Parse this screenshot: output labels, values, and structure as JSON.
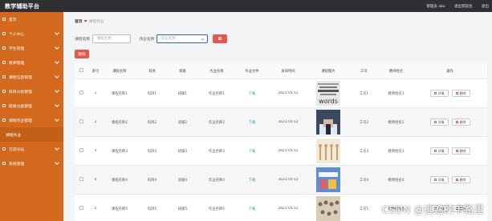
{
  "app": {
    "title": "教学辅助平台"
  },
  "topbar": {
    "links": [
      "管理员 abo",
      "退出到前台",
      "退出"
    ]
  },
  "sidebar": {
    "items": [
      {
        "label": "首页",
        "sub": false,
        "chevron": false
      },
      {
        "label": "个人中心",
        "sub": false,
        "chevron": true
      },
      {
        "label": "学生管理",
        "sub": false,
        "chevron": true
      },
      {
        "label": "教师管理",
        "sub": false,
        "chevron": true
      },
      {
        "label": "课程信息管理",
        "sub": false,
        "chevron": true
      },
      {
        "label": "科目分类管理",
        "sub": false,
        "chevron": true
      },
      {
        "label": "班级分类管理",
        "sub": false,
        "chevron": true
      },
      {
        "label": "课程作业管理",
        "sub": false,
        "chevron": true
      },
      {
        "label": "课程作业",
        "sub": true,
        "chevron": false
      },
      {
        "label": "交流论坛",
        "sub": false,
        "chevron": true
      },
      {
        "label": "系统管理",
        "sub": false,
        "chevron": true
      }
    ]
  },
  "breadcrumb": {
    "home": "首页",
    "current": "课程作业"
  },
  "search": {
    "course_label": "课程名称",
    "course_placeholder": "课程名称",
    "homework_label": "作业名称",
    "homework_placeholder": "作业名称"
  },
  "toolbar": {
    "delete_label": "删除"
  },
  "table": {
    "headers": [
      "索引",
      "课程名称",
      "科目",
      "班级",
      "作业名称",
      "作业文件",
      "发布时间",
      "课程图片",
      "工号",
      "教师姓名",
      "操作"
    ],
    "rows": [
      {
        "index": "1",
        "course": "课程名称1",
        "subject": "科目1",
        "class": "班级1",
        "homework": "作业名称1",
        "file": "下载",
        "time": "2021-05-12",
        "no": "工号1",
        "teacher": "教师姓名1",
        "thumb": "words"
      },
      {
        "index": "2",
        "course": "课程名称2",
        "subject": "科目2",
        "class": "班级2",
        "homework": "作业名称2",
        "file": "下载",
        "time": "2021-05-12",
        "no": "工号2",
        "teacher": "教师姓名2",
        "thumb": "suit"
      },
      {
        "index": "3",
        "course": "课程名称3",
        "subject": "科目3",
        "class": "班级3",
        "homework": "作业名称3",
        "file": "下载",
        "time": "2021-05-12",
        "no": "工号3",
        "teacher": "教师姓名3",
        "thumb": "figures"
      },
      {
        "index": "4",
        "course": "课程名称4",
        "subject": "科目4",
        "class": "班级4",
        "homework": "作业名称4",
        "file": "下载",
        "time": "2021-05-12",
        "no": "工号4",
        "teacher": "教师姓名4",
        "thumb": "blocks"
      },
      {
        "index": "5",
        "course": "课程名称5",
        "subject": "科目5",
        "class": "班级5",
        "homework": "作业名称5",
        "file": "下载",
        "time": "2021-05-12",
        "no": "工号5",
        "teacher": "教师姓名5",
        "thumb": "crowd"
      }
    ],
    "actions": {
      "detail": "详情",
      "delete": "删除"
    }
  },
  "watermark": "CSDN @逃逸的卡路里"
}
